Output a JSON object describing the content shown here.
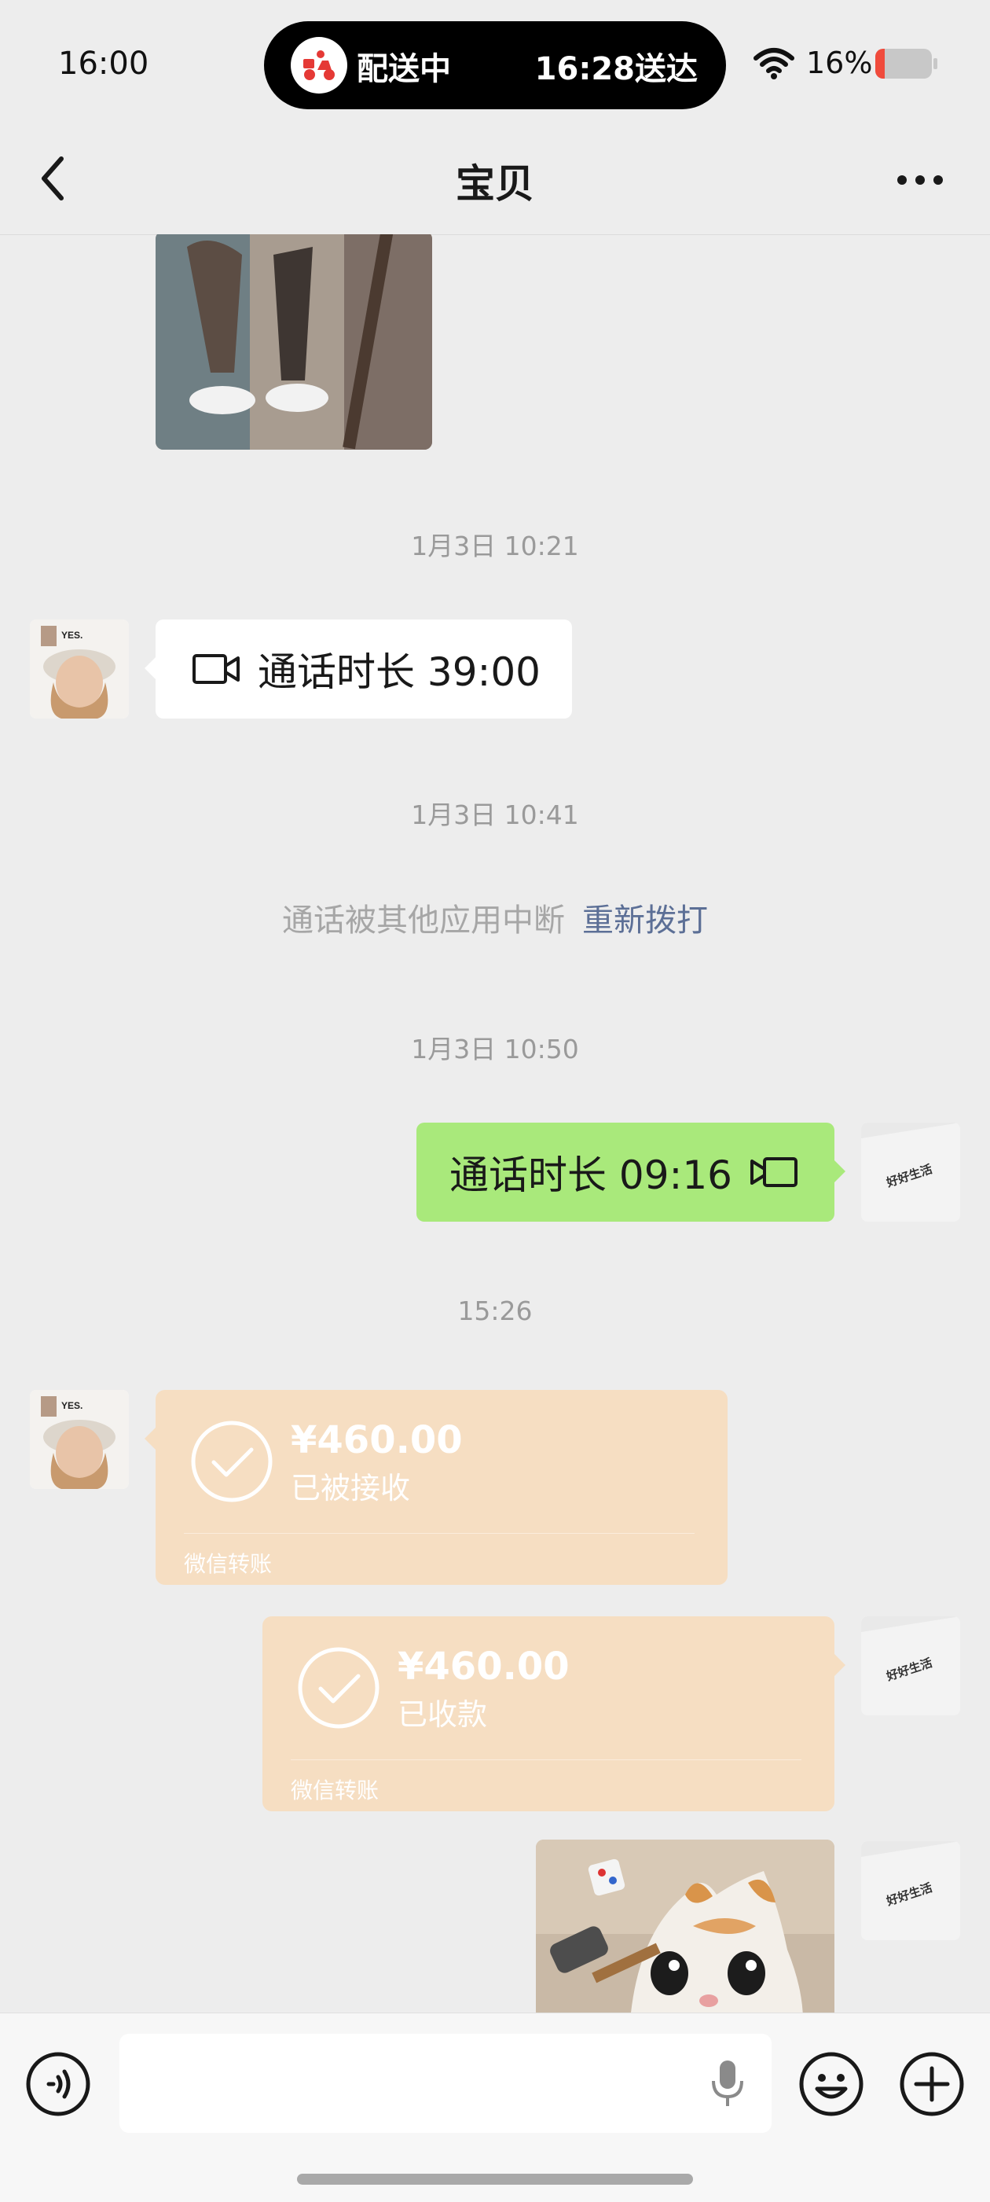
{
  "status_bar": {
    "time": "16:00",
    "delivery_status": "配送中",
    "delivery_eta": "16:28送达",
    "battery_percent": "16%"
  },
  "nav": {
    "title": "宝贝",
    "back_icon": "chevron-left-icon",
    "more_icon": "more-dots-icon"
  },
  "messages": {
    "ts1": "1月3日 10:21",
    "call1": "通话时长 39:00",
    "ts2": "1月3日 10:41",
    "interrupted": "通话被其他应用中断",
    "redial": "重新拨打",
    "ts3": "1月3日 10:50",
    "call2": "通话时长 09:16",
    "ts4": "15:26",
    "transfer1": {
      "amount": "¥460.00",
      "state": "已被接收",
      "label": "微信转账"
    },
    "transfer2": {
      "amount": "¥460.00",
      "state": "已收款",
      "label": "微信转账"
    },
    "my_avatar_text": "好好生活"
  },
  "colors": {
    "background": "#ededed",
    "green_bubble": "#a9e97b",
    "transfer_bubble": "#f6dec2",
    "link": "#5c6f96"
  }
}
